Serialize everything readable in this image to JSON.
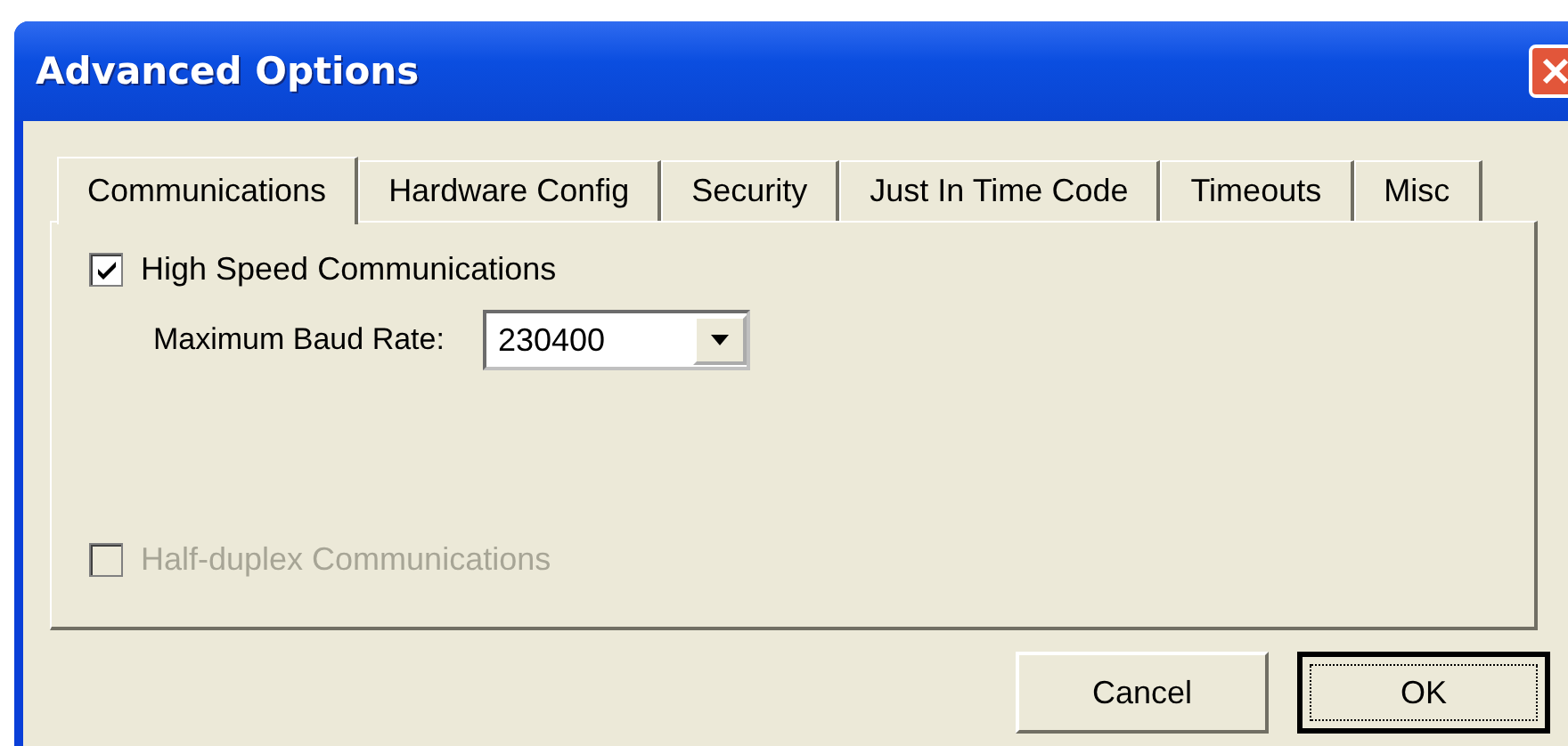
{
  "window": {
    "title": "Advanced Options"
  },
  "tabs": [
    {
      "label": "Communications",
      "selected": true
    },
    {
      "label": "Hardware Config",
      "selected": false
    },
    {
      "label": "Security",
      "selected": false
    },
    {
      "label": "Just In Time Code",
      "selected": false
    },
    {
      "label": "Timeouts",
      "selected": false
    },
    {
      "label": "Misc",
      "selected": false
    }
  ],
  "high_speed": {
    "label": "High Speed Communications",
    "checked": true,
    "disabled": false
  },
  "baud_rate": {
    "label": "Maximum Baud Rate:",
    "value": "230400"
  },
  "half_duplex": {
    "label": "Half-duplex Communications",
    "checked": false,
    "disabled": true
  },
  "buttons": [
    {
      "label": "Cancel",
      "focused": false
    },
    {
      "label": "OK",
      "focused": true
    }
  ]
}
